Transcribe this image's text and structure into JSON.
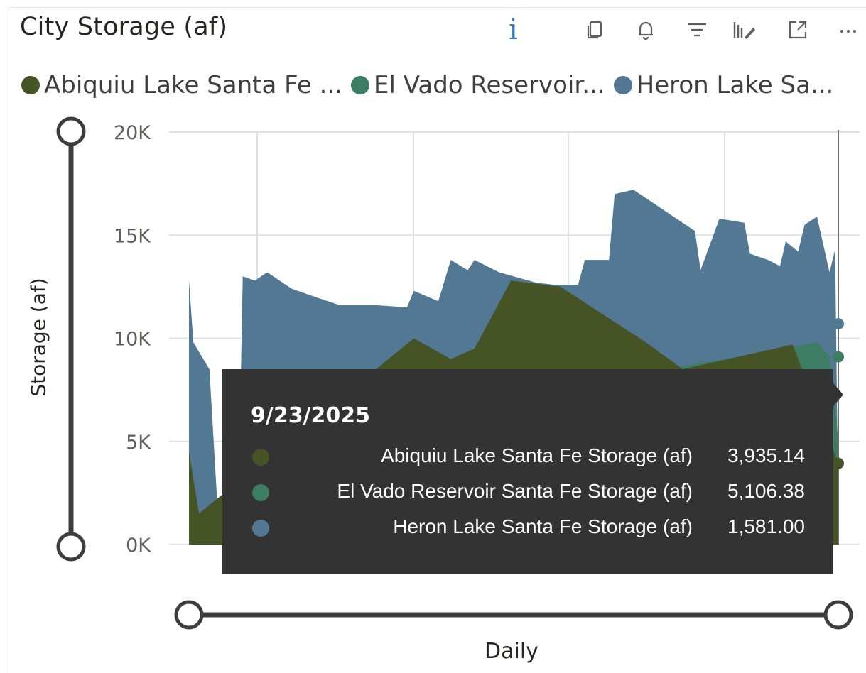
{
  "visual": {
    "title": "City Storage (af)",
    "info_icon": "info-icon",
    "header_icons": [
      "copy-icon",
      "bell-icon",
      "filter-icon",
      "analytics-icon",
      "focus-mode-icon",
      "more-options-icon"
    ]
  },
  "legend": {
    "items": [
      {
        "label": "Abiquiu Lake Santa Fe ...",
        "color": "#465325"
      },
      {
        "label": "El Vado Reservoir...",
        "color": "#3c7d64"
      },
      {
        "label": "Heron Lake Sa...",
        "color": "#527894"
      }
    ]
  },
  "axes": {
    "y_title": "Storage (af)",
    "x_title": "Daily",
    "y_ticks": [
      "20K",
      "15K",
      "10K",
      "5K",
      "0K"
    ]
  },
  "tooltip": {
    "date": "9/23/2025",
    "rows": [
      {
        "label": "Abiquiu Lake Santa Fe Storage (af)",
        "value": "3,935.14",
        "color": "#465325"
      },
      {
        "label": "El Vado Reservoir Santa Fe Storage (af)",
        "value": "5,106.38",
        "color": "#3c7d64"
      },
      {
        "label": "Heron Lake Santa Fe Storage (af)",
        "value": "1,581.00",
        "color": "#527894"
      }
    ]
  },
  "chart_data": {
    "type": "area",
    "title": "City Storage (af)",
    "xlabel": "Daily",
    "ylabel": "Storage (af)",
    "ylim": [
      0,
      20000
    ],
    "y_ticks": [
      0,
      5000,
      10000,
      15000,
      20000
    ],
    "grid": true,
    "legend_position": "top",
    "x_range": [
      "2021-04",
      "2025-09-23"
    ],
    "series": [
      {
        "name": "Heron Lake Santa Fe Storage (af)",
        "color": "#527894",
        "points": [
          [
            "2021-04-20",
            12800
          ],
          [
            "2021-05-01",
            9800
          ],
          [
            "2021-06-10",
            8500
          ],
          [
            "2021-07-01",
            1500
          ],
          [
            "2021-08-01",
            400
          ],
          [
            "2021-08-20",
            800
          ],
          [
            "2021-09-01",
            13000
          ],
          [
            "2021-10-01",
            12800
          ],
          [
            "2021-11-01",
            13200
          ],
          [
            "2022-01-01",
            12400
          ],
          [
            "2022-03-01",
            12000
          ],
          [
            "2022-05-01",
            11600
          ],
          [
            "2022-08-01",
            11600
          ],
          [
            "2022-10-15",
            11500
          ],
          [
            "2022-11-01",
            12300
          ],
          [
            "2023-01-01",
            11800
          ],
          [
            "2023-02-01",
            13800
          ],
          [
            "2023-03-15",
            13300
          ],
          [
            "2023-04-01",
            13800
          ],
          [
            "2023-06-01",
            13200
          ],
          [
            "2023-09-01",
            12700
          ],
          [
            "2023-10-15",
            12600
          ],
          [
            "2023-12-15",
            12600
          ],
          [
            "2024-01-01",
            13800
          ],
          [
            "2024-03-01",
            13800
          ],
          [
            "2024-03-15",
            17000
          ],
          [
            "2024-05-01",
            17200
          ],
          [
            "2024-08-01",
            16000
          ],
          [
            "2024-10-01",
            15200
          ],
          [
            "2024-10-15",
            13300
          ],
          [
            "2024-12-01",
            15800
          ],
          [
            "2025-02-01",
            15600
          ],
          [
            "2025-02-15",
            14100
          ],
          [
            "2025-04-01",
            13800
          ],
          [
            "2025-05-01",
            13500
          ],
          [
            "2025-05-15",
            14700
          ],
          [
            "2025-06-15",
            14200
          ],
          [
            "2025-07-01",
            15500
          ],
          [
            "2025-08-01",
            15900
          ],
          [
            "2025-09-01",
            13200
          ],
          [
            "2025-09-15",
            14300
          ],
          [
            "2025-09-23",
            1581
          ]
        ]
      },
      {
        "name": "El Vado Reservoir Santa Fe Storage (af)",
        "color": "#3c7d64",
        "points": [
          [
            "2021-04-20",
            0
          ],
          [
            "2021-07-01",
            0
          ],
          [
            "2021-08-10",
            4800
          ],
          [
            "2021-09-01",
            4800
          ],
          [
            "2025-08-01",
            9800
          ],
          [
            "2025-09-01",
            9100
          ],
          [
            "2025-09-23",
            5106.38
          ]
        ]
      },
      {
        "name": "Abiquiu Lake Santa Fe Storage (af)",
        "color": "#465325",
        "points": [
          [
            "2021-04-20",
            4500
          ],
          [
            "2021-05-15",
            1500
          ],
          [
            "2022-11-01",
            10000
          ],
          [
            "2023-02-01",
            9000
          ],
          [
            "2023-04-01",
            9500
          ],
          [
            "2023-07-01",
            12800
          ],
          [
            "2023-11-01",
            12500
          ],
          [
            "2024-06-01",
            9800
          ],
          [
            "2024-09-01",
            8500
          ],
          [
            "2025-06-01",
            9700
          ],
          [
            "2025-09-23",
            3935.14
          ]
        ]
      }
    ]
  }
}
